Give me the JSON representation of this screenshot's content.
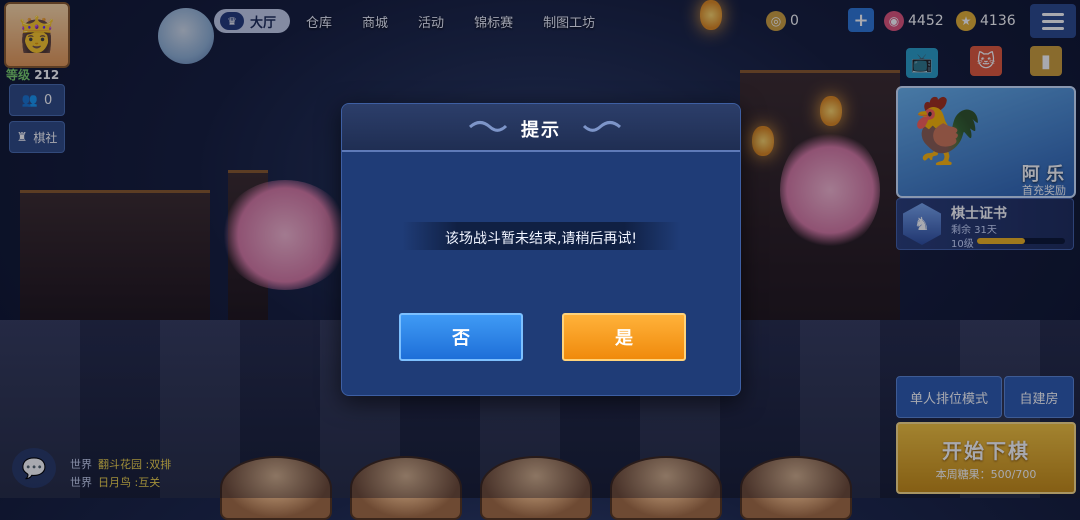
{
  "player": {
    "level_label": "等级",
    "level_value": "212"
  },
  "side": {
    "friends_count": "0",
    "club_label": "棋社"
  },
  "nav": {
    "hall_label": "大厅",
    "items": [
      "仓库",
      "商城",
      "活动",
      "锦标赛",
      "制图工坊"
    ]
  },
  "resources": {
    "coins": "0",
    "gems": "4452",
    "tickets": "4136"
  },
  "promo": {
    "name": "阿 乐",
    "subtitle": "首充奖励"
  },
  "certificate": {
    "title": "棋士证书",
    "remaining": "剩余 31天",
    "level": "10级",
    "progress": 0.55
  },
  "actions": {
    "rank_mode": "单人排位模式",
    "custom_room": "自建房",
    "start_label": "开始下棋",
    "weekly_label": "本周糖果：500/700"
  },
  "chat": {
    "lines": [
      {
        "channel": "世界",
        "text": "翻斗花园 :双排"
      },
      {
        "channel": "世界",
        "text": "日月鸟 :互关"
      }
    ]
  },
  "dialog": {
    "title": "提示",
    "message": "该场战斗暂未结束,请稍后再试!",
    "no_label": "否",
    "yes_label": "是"
  },
  "colors": {
    "dialog_bg": "#1f3c77",
    "no_button": "#2f86ea",
    "yes_button": "#f59a1c",
    "start_button": "#e0a92a"
  }
}
